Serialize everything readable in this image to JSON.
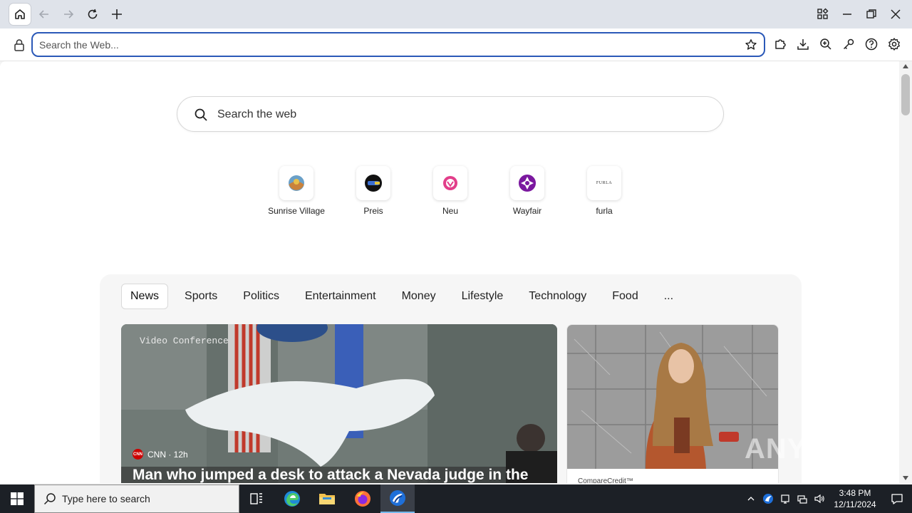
{
  "browser": {
    "address_placeholder": "Search the Web..."
  },
  "newtab": {
    "search_placeholder": "Search the web",
    "tiles": [
      {
        "label": "Sunrise Village"
      },
      {
        "label": "Preis"
      },
      {
        "label": "Neu"
      },
      {
        "label": "Wayfair"
      },
      {
        "label": "furla",
        "icon_text": "FURLA"
      }
    ]
  },
  "feed": {
    "tabs": [
      {
        "label": "News"
      },
      {
        "label": "Sports"
      },
      {
        "label": "Politics"
      },
      {
        "label": "Entertainment"
      },
      {
        "label": "Money"
      },
      {
        "label": "Lifestyle"
      },
      {
        "label": "Technology"
      },
      {
        "label": "Food"
      },
      {
        "label": "..."
      }
    ],
    "hero": {
      "overlay_text": "Video Conference",
      "source": "CNN · 12h",
      "title": "Man who jumped a desk to attack a Nevada judge in the"
    },
    "side_card": {
      "source": "CompareCredit™"
    }
  },
  "watermark": "ANY RUN",
  "taskbar": {
    "search_placeholder": "Type here to search",
    "time": "3:48 PM",
    "date": "12/11/2024"
  },
  "colors": {
    "accent": "#2b59b8",
    "taskbar": "#1c2026",
    "titlebar": "#dfe3ea"
  }
}
